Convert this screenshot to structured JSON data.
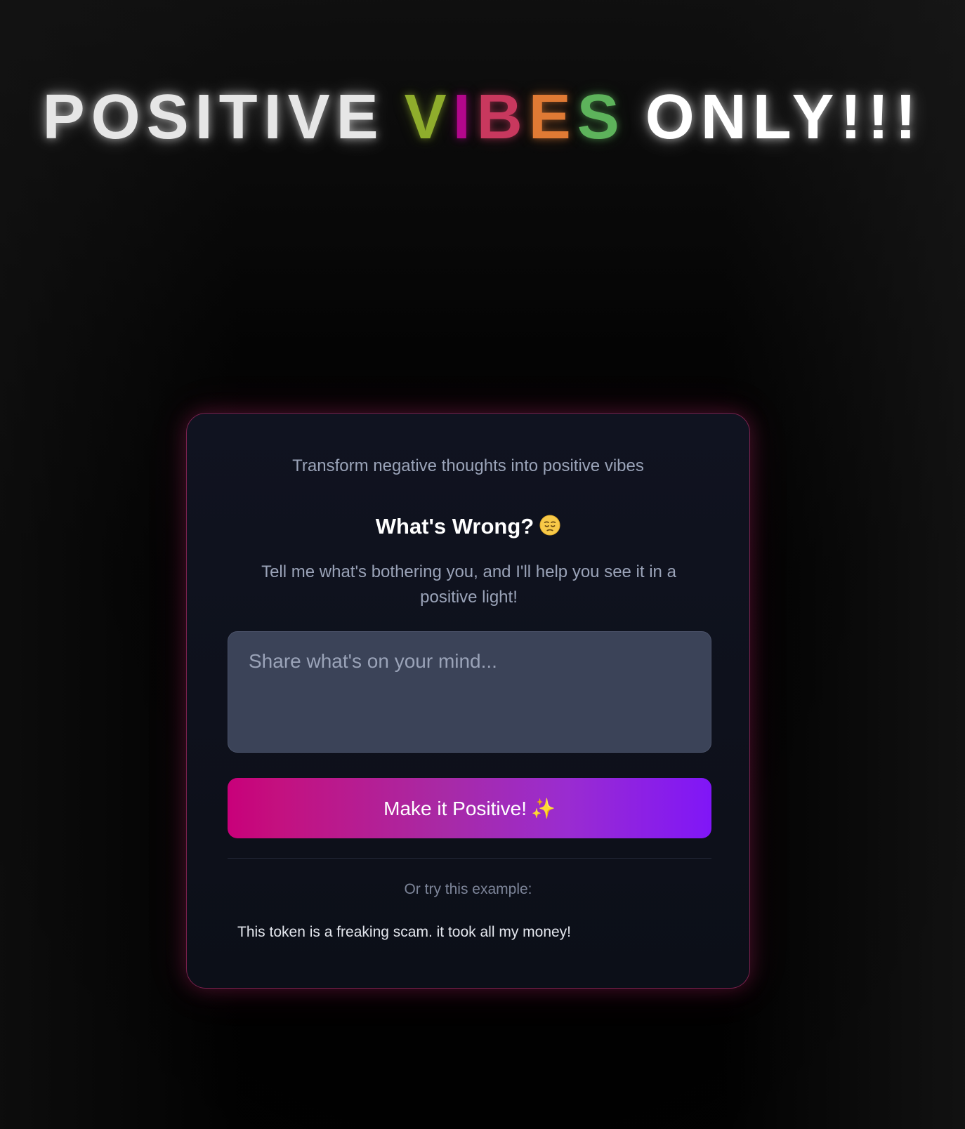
{
  "hero": {
    "word_before": "POSITIVE",
    "vibes_letters": [
      {
        "char": "V",
        "color": "#8fad2c"
      },
      {
        "char": "I",
        "color": "#b3078c"
      },
      {
        "char": "B",
        "color": "#c8385e"
      },
      {
        "char": "E",
        "color": "#e07a34"
      },
      {
        "char": "S",
        "color": "#5db35b"
      }
    ],
    "word_after": "ONLY!!!"
  },
  "card": {
    "tagline": "Transform negative thoughts into positive vibes",
    "heading": "What's Wrong?",
    "heading_emoji": "pensive-face-icon",
    "description": "Tell me what's bothering you, and I'll help you see it in a positive light!",
    "input": {
      "value": "",
      "placeholder": "Share what's on your mind..."
    },
    "button_label": "Make it Positive!",
    "button_icon": "sparkles-icon",
    "example_label": "Or try this example:",
    "example_text": "This token is a freaking scam. it took all my money!"
  },
  "colors": {
    "accent_pink": "#c8007a",
    "accent_purple": "#8016f7",
    "card_border": "#d63078",
    "input_bg": "#3b4358"
  }
}
